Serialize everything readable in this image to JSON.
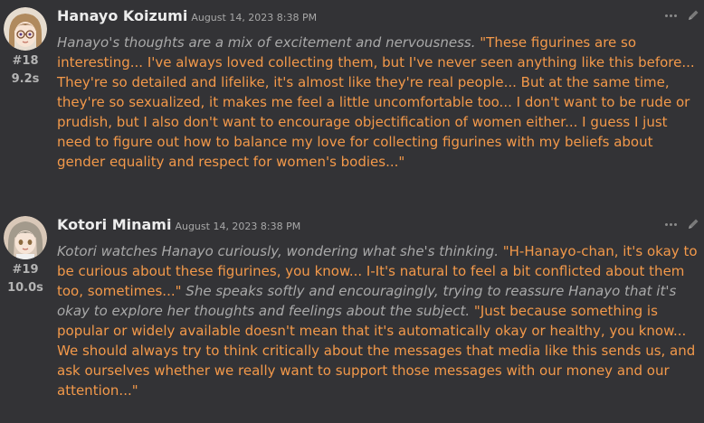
{
  "messages": [
    {
      "name": "Hanayo Koizumi",
      "timestamp": "August 14, 2023 8:38 PM",
      "number": "#18",
      "time": "9.2s",
      "parts": [
        {
          "style": "italic",
          "text": "Hanayo's thoughts are a mix of excitement and nervousness."
        },
        {
          "style": "quote",
          "text": "\"These figurines are so interesting... I've always loved collecting them, but I've never seen anything like this before... They're so detailed and lifelike, it's almost like they're real people... But at the same time, they're so sexualized, it makes me feel a little uncomfortable too... I don't want to be rude or prudish, but I also don't want to encourage objectification of women either... I guess I just need to figure out how to balance my love for collecting figurines with my beliefs about gender equality and respect for women's bodies...\""
        }
      ]
    },
    {
      "name": "Kotori Minami",
      "timestamp": "August 14, 2023 8:38 PM",
      "number": "#19",
      "time": "10.0s",
      "parts": [
        {
          "style": "italic",
          "text": "Kotori watches Hanayo curiously, wondering what she's thinking."
        },
        {
          "style": "quote",
          "text": "\"H-Hanayo-chan, it's okay to be curious about these figurines, you know... I-It's natural to feel a bit conflicted about them too, sometimes...\""
        },
        {
          "style": "italic",
          "text": "She speaks softly and encouragingly, trying to reassure Hanayo that it's okay to explore her thoughts and feelings about the subject."
        },
        {
          "style": "quote",
          "text": "\"Just because something is popular or widely available doesn't mean that it's automatically okay or healthy, you know... We should always try to think critically about the messages that media like this sends us, and ask ourselves whether we really want to support those messages with our money and our attention...\""
        }
      ]
    }
  ],
  "icons": {
    "more": "more-options-icon",
    "edit": "pencil-edit-icon"
  },
  "colors": {
    "background": "#333336",
    "quote": "#f3994a",
    "narration": "#a9a9a9"
  }
}
